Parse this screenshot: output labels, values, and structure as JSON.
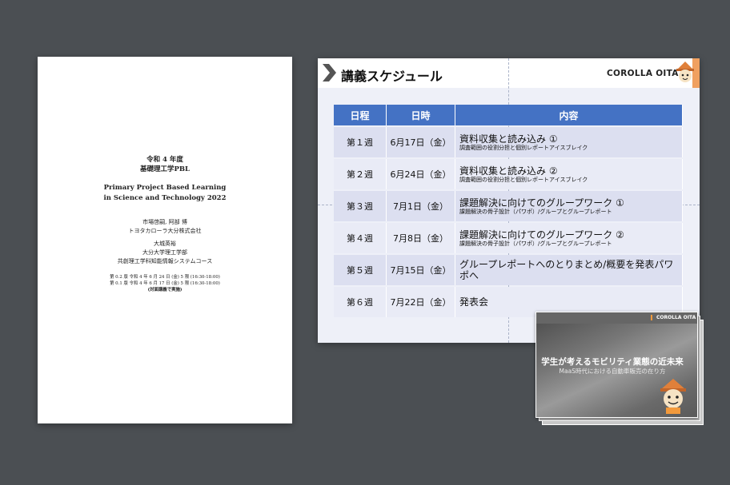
{
  "document": {
    "era_year": "令和 4 年度",
    "course_jp": "基礎理工学PBL",
    "title_en_1": "Primary Project Based Learning",
    "title_en_2": "in Science and Technology 2022",
    "author1_name": "市場啓嗣, 阿部 博",
    "author1_org": "トヨタカローラ大分株式会社",
    "author2_name": "大城英裕",
    "author2_org1": "大分大学理工学部",
    "author2_org2": "共創理工学科知能情報システムコース",
    "version_2": "第 0.2 版 令和 4 年 6 月 24 日 (金) 5 限 (16:30-18:00)",
    "version_1": "第 0.1 版 令和 4 年 6 月 17 日 (金) 5 限 (16:30-18:00)",
    "note": "(対面講義で実施)"
  },
  "slide": {
    "title": "講義スケジュール",
    "brand": "COROLLA OITA",
    "headers": [
      "日程",
      "日時",
      "内容"
    ],
    "rows": [
      {
        "week": "第１週",
        "date": "6月17日（金）",
        "content": "資料収集と読み込み ①",
        "sub": "調査範囲の役割分担と個別レポートアイスブレイク"
      },
      {
        "week": "第２週",
        "date": "6月24日（金）",
        "content": "資料収集と読み込み ②",
        "sub": "調査範囲の役割分担と個別レポートアイスブレイク"
      },
      {
        "week": "第３週",
        "date": "7月1日（金）",
        "content": "課題解決に向けてのグループワーク ①",
        "sub": "課題解決の骨子設計（パワポ）/グループとグループレポート"
      },
      {
        "week": "第４週",
        "date": "7月8日（金）",
        "content": "課題解決に向けてのグループワーク ②",
        "sub": "課題解決の骨子設計（パワポ）/グループとグループレポート"
      },
      {
        "week": "第５週",
        "date": "7月15日（金）",
        "content": "グループレポートへのとりまとめ/概要を発表パワポへ",
        "sub": ""
      },
      {
        "week": "第６週",
        "date": "7月22日（金）",
        "content": "発表会",
        "sub": ""
      }
    ]
  },
  "thumbnail": {
    "brand": "COROLLA OITA",
    "title": "学生が考えるモビリティ業態の近未来",
    "subtitle": "MaaS時代における自動車販売の在り方"
  },
  "colors": {
    "header_blue": "#4472c4",
    "row_light": "#dcdff0",
    "accent_orange": "#f39a3c",
    "background": "#4b4f53"
  },
  "icons": [
    "chevron-right-icon",
    "mascot-icon"
  ]
}
